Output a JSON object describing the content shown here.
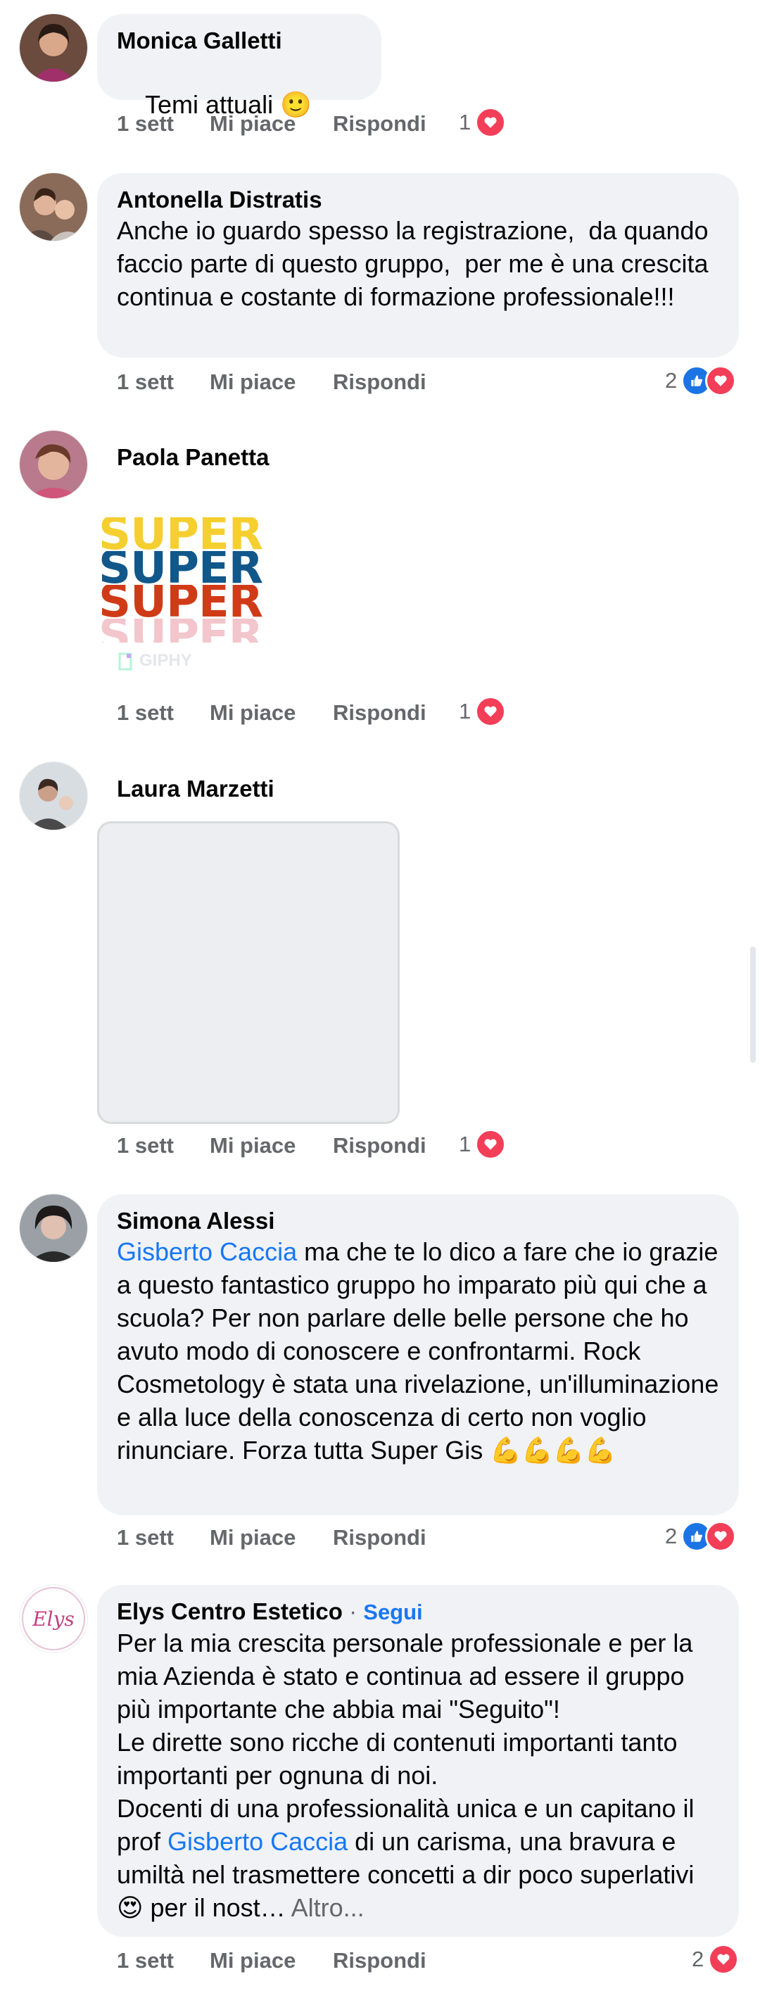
{
  "comments": [
    {
      "name": "Monica Galletti",
      "text": "Temi attuali 🙂",
      "time": "1 sett",
      "like_label": "Mi piace",
      "reply_label": "Rispondi",
      "reaction_count": "1",
      "reactions": [
        "love"
      ]
    },
    {
      "name": "Antonella Distratis",
      "text": "Anche io guardo spesso la registrazione,  da quando faccio parte di questo gruppo,  per me è una crescita continua e costante di formazione professionale!!!",
      "time": "1 sett",
      "like_label": "Mi piace",
      "reply_label": "Rispondi",
      "reaction_count": "2",
      "reactions": [
        "like",
        "love"
      ]
    },
    {
      "name": "Paola Panetta",
      "gif_words": [
        "SUPER",
        "SUPER",
        "SUPER",
        "SUPER"
      ],
      "gif_source": "GIPHY",
      "time": "1 sett",
      "like_label": "Mi piace",
      "reply_label": "Rispondi",
      "reaction_count": "1",
      "reactions": [
        "love"
      ]
    },
    {
      "name": "Laura Marzetti",
      "time": "1 sett",
      "like_label": "Mi piace",
      "reply_label": "Rispondi",
      "reaction_count": "1",
      "reactions": [
        "love"
      ]
    },
    {
      "name": "Simona Alessi",
      "mention": "Gisberto Caccia",
      "text": " ma che te lo dico a fare che io grazie a questo fantastico gruppo ho imparato più qui che a scuola? Per non parlare delle belle persone che ho avuto modo di conoscere e confrontarmi. Rock Cosmetology è stata una rivelazione, un'illuminazione e alla luce della conoscenza di certo non voglio rinunciare. Forza tutta Super Gis 💪💪💪💪",
      "time": "1 sett",
      "like_label": "Mi piace",
      "reply_label": "Rispondi",
      "reaction_count": "2",
      "reactions": [
        "like",
        "love"
      ]
    },
    {
      "name": "Elys Centro Estetico",
      "separator": " · ",
      "follow_label": "Segui",
      "text_part1": "Per la mia crescita personale professionale e per la mia Azienda è stato e continua ad essere il gruppo più importante che abbia mai \"Seguito\"!\nLe dirette sono ricche di contenuti importanti tanto importanti per ognuna di noi.\nDocenti di una professionalità unica e un capitano il prof ",
      "mention": "Gisberto Caccia",
      "text_part2": " di un carisma, una bravura e umiltà nel trasmettere concetti a dir poco superlativi 😍 per il nost…",
      "more_label": " Altro...",
      "avatar_text": "Elys",
      "time": "1 sett",
      "like_label": "Mi piace",
      "reply_label": "Rispondi",
      "reaction_count": "2",
      "reactions": [
        "love"
      ]
    }
  ],
  "colors": {
    "bubble": "#f0f2f5",
    "link": "#1877f2",
    "muted": "#65676b",
    "love": "#f33e58",
    "like": "#1b74e4"
  }
}
